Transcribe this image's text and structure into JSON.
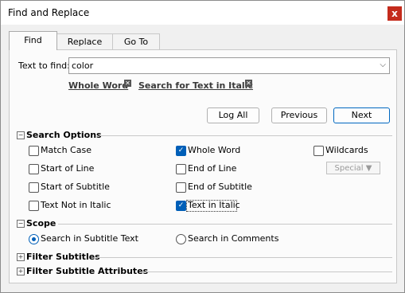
{
  "window": {
    "title": "Find and Replace",
    "close_glyph": "x"
  },
  "tabs": [
    {
      "label": "Find",
      "active": true
    },
    {
      "label": "Replace",
      "active": false
    },
    {
      "label": "Go To",
      "active": false
    }
  ],
  "find": {
    "label": "Text to find:",
    "value": "color",
    "dropdown_glyph": "⌵"
  },
  "chips": [
    {
      "label": "Whole Word",
      "remove_glyph": "✕"
    },
    {
      "label": "Search for Text in Italic",
      "remove_glyph": "✕"
    }
  ],
  "buttons": {
    "log_all": "Log All",
    "previous": "Previous",
    "next": "Next"
  },
  "search_options": {
    "header": "Search Options",
    "toggle_glyph": "−",
    "items": {
      "match_case": {
        "label": "Match Case",
        "checked": false
      },
      "whole_word": {
        "label": "Whole Word",
        "checked": true
      },
      "wildcards": {
        "label": "Wildcards",
        "checked": false
      },
      "start_of_line": {
        "label": "Start of Line",
        "checked": false
      },
      "end_of_line": {
        "label": "End of Line",
        "checked": false
      },
      "start_of_subtitle": {
        "label": "Start of Subtitle",
        "checked": false
      },
      "end_of_subtitle": {
        "label": "End of Subtitle",
        "checked": false
      },
      "text_not_in_italic": {
        "label": "Text Not in Italic",
        "checked": false
      },
      "text_in_italic": {
        "label": "Text in Italic",
        "checked": true
      }
    },
    "special": "Special ▼",
    "check_glyph": "✓"
  },
  "scope": {
    "header": "Scope",
    "toggle_glyph": "−",
    "options": {
      "subtitle_text": {
        "label": "Search in Subtitle Text",
        "selected": true
      },
      "comments": {
        "label": "Search in Comments",
        "selected": false
      }
    }
  },
  "filter_subtitles": {
    "header": "Filter Subtitles",
    "toggle_glyph": "+"
  },
  "filter_attributes": {
    "header": "Filter Subtitle Attributes",
    "toggle_glyph": "+"
  },
  "colors": {
    "accent": "#005fb8",
    "close": "#c42b1c"
  }
}
